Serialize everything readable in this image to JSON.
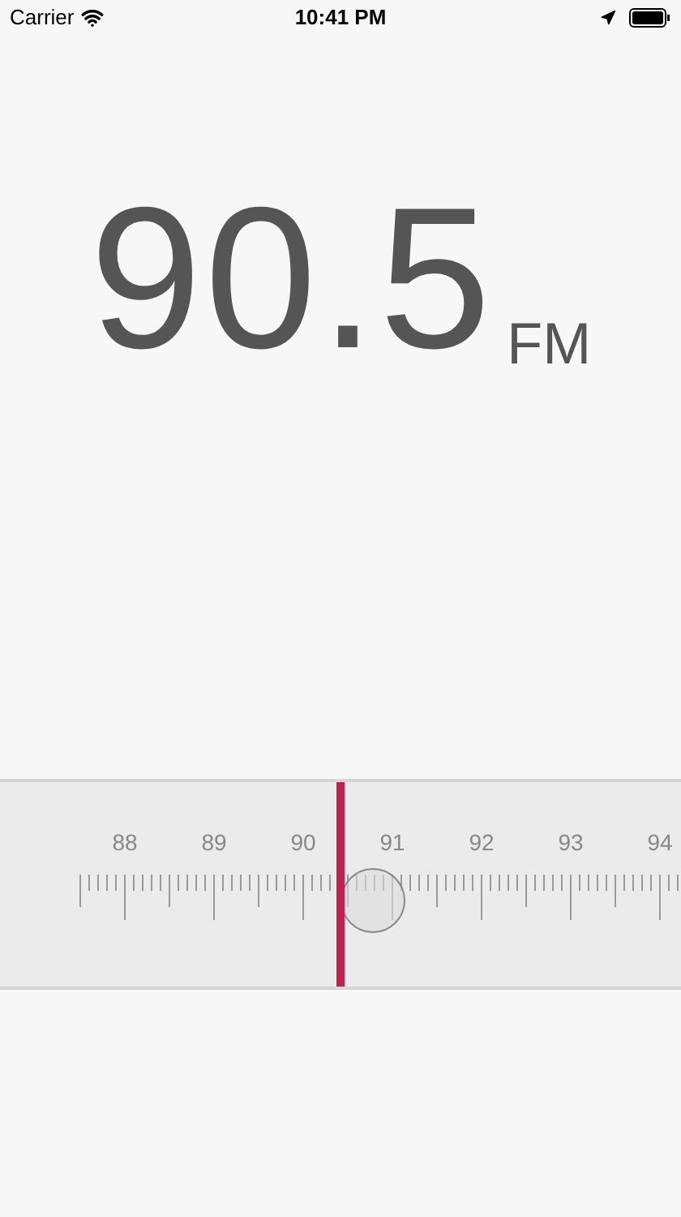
{
  "status_bar": {
    "carrier": "Carrier",
    "time": "10:41 PM"
  },
  "frequency": {
    "value": "90.5",
    "band": "FM"
  },
  "dial": {
    "labels": [
      "88",
      "89",
      "90",
      "91",
      "92",
      "93",
      "94"
    ],
    "level": 0.5
  }
}
